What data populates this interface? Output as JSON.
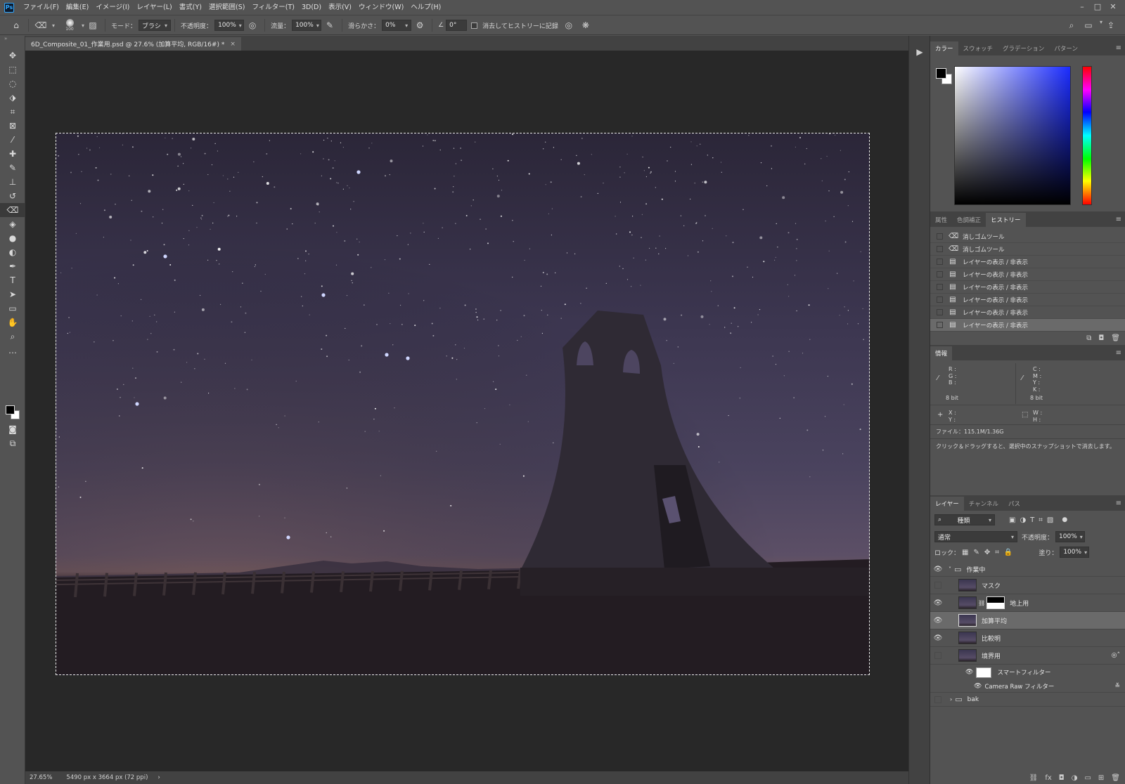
{
  "menu": [
    "ファイル(F)",
    "編集(E)",
    "イメージ(I)",
    "レイヤー(L)",
    "書式(Y)",
    "選択範囲(S)",
    "フィルター(T)",
    "3D(D)",
    "表示(V)",
    "ウィンドウ(W)",
    "ヘルプ(H)"
  ],
  "options": {
    "brush_size": "100",
    "mode_label": "モード：",
    "mode_value": "ブラシ",
    "opacity_label": "不透明度：",
    "opacity_value": "100%",
    "flow_label": "流量：",
    "flow_value": "100%",
    "smoothing_label": "滑らかさ：",
    "smoothing_value": "0%",
    "angle_value": "0°",
    "history_checkbox_label": "消去してヒストリーに記録"
  },
  "document": {
    "tab_title": "6D_Composite_01_作業用.psd @ 27.6% (加算平均, RGB/16#) *",
    "zoom": "27.65%",
    "dimensions": "5490 px x 3664 px (72 ppi)"
  },
  "color_panel": {
    "tabs": [
      "カラー",
      "スウォッチ",
      "グラデーション",
      "パターン"
    ]
  },
  "history_panel": {
    "tabs": [
      "属性",
      "色調補正",
      "ヒストリー"
    ],
    "items": [
      "消しゴムツール",
      "消しゴムツール",
      "レイヤーの表示 / 非表示",
      "レイヤーの表示 / 非表示",
      "レイヤーの表示 / 非表示",
      "レイヤーの表示 / 非表示",
      "レイヤーの表示 / 非表示",
      "レイヤーの表示 / 非表示"
    ]
  },
  "info_panel": {
    "tab": "情報",
    "rgb": "R :\nG :\nB :",
    "cmyk": "C :\nM :\nY :\nK :",
    "bit_left": "8 bit",
    "bit_right": "8 bit",
    "xy": "X :\nY :",
    "wh": "W :\nH :",
    "file_size": "ファイル：115.1M/1.36G",
    "hint": "クリック＆ドラッグすると、選択中のスナップショットで消去します。"
  },
  "layers_panel": {
    "tabs": [
      "レイヤー",
      "チャンネル",
      "パス"
    ],
    "filter": "種類",
    "blend_mode": "通常",
    "opacity_label": "不透明度：",
    "opacity_value": "100%",
    "lock_label": "ロック：",
    "fill_label": "塗り：",
    "fill_value": "100%",
    "layers": [
      "作業中",
      "マスク",
      "地上用",
      "加算平均",
      "比較明",
      "境界用",
      "スマートフィルター",
      "Camera Raw フィルター",
      "bak"
    ]
  }
}
